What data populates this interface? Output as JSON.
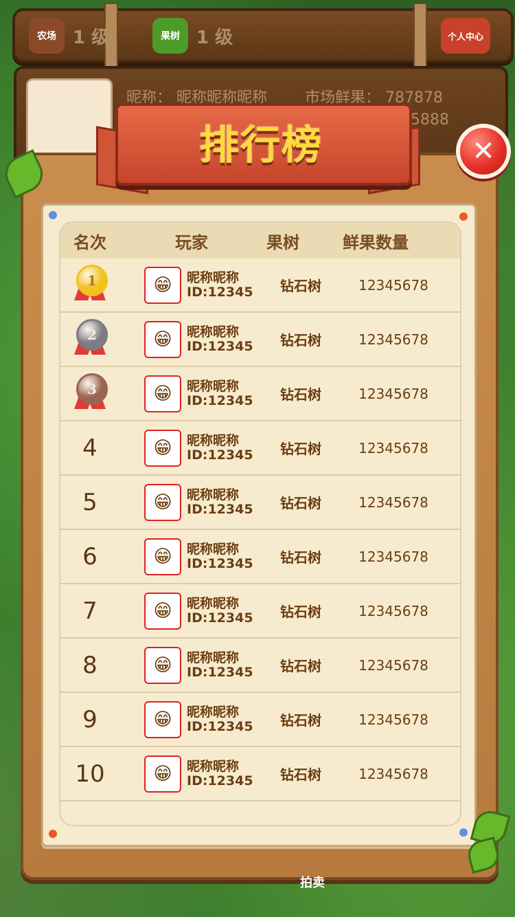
{
  "hud": {
    "farm_label": "农场",
    "farm_level": "1 级",
    "orchard_label": "果树",
    "orchard_level": "1 级",
    "profile_label": "个人中心"
  },
  "profile_panel": {
    "nickname_label": "昵称：",
    "nickname_value": "昵称昵称昵称",
    "fruit_label": "市场鲜果：",
    "fruit_value": "787878",
    "second_value": "85888"
  },
  "modal": {
    "title": "排行榜",
    "close_icon": "close-icon",
    "columns": [
      "名次",
      "玩家",
      "果树",
      "鲜果数量"
    ],
    "rows": [
      {
        "rank": "1",
        "name": "昵称昵称",
        "id": "ID:12345",
        "tree": "钻石树",
        "count": "12345678",
        "medal": "gold"
      },
      {
        "rank": "2",
        "name": "昵称昵称",
        "id": "ID:12345",
        "tree": "钻石树",
        "count": "12345678",
        "medal": "silver"
      },
      {
        "rank": "3",
        "name": "昵称昵称",
        "id": "ID:12345",
        "tree": "钻石树",
        "count": "12345678",
        "medal": "bronze"
      },
      {
        "rank": "4",
        "name": "昵称昵称",
        "id": "ID:12345",
        "tree": "钻石树",
        "count": "12345678"
      },
      {
        "rank": "5",
        "name": "昵称昵称",
        "id": "ID:12345",
        "tree": "钻石树",
        "count": "12345678"
      },
      {
        "rank": "6",
        "name": "昵称昵称",
        "id": "ID:12345",
        "tree": "钻石树",
        "count": "12345678"
      },
      {
        "rank": "7",
        "name": "昵称昵称",
        "id": "ID:12345",
        "tree": "钻石树",
        "count": "12345678"
      },
      {
        "rank": "8",
        "name": "昵称昵称",
        "id": "ID:12345",
        "tree": "钻石树",
        "count": "12345678"
      },
      {
        "rank": "9",
        "name": "昵称昵称",
        "id": "ID:12345",
        "tree": "钻石树",
        "count": "12345678"
      },
      {
        "rank": "10",
        "name": "昵称昵称",
        "id": "ID:12345",
        "tree": "钻石树",
        "count": "12345678"
      }
    ]
  },
  "bottom_nav": {
    "auction_label": "拍卖"
  },
  "colors": {
    "gold": "#f2c21d",
    "silver": "#7d7b86",
    "bronze": "#9a6450",
    "text_brown": "#6c3d10",
    "title_yellow": "#ffd93e"
  }
}
